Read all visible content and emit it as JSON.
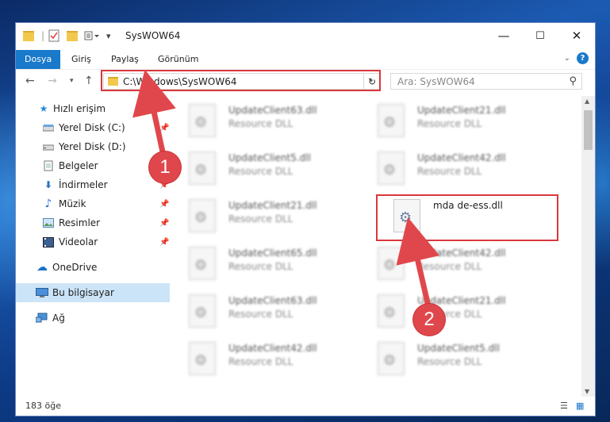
{
  "window": {
    "title": "SysWOW64",
    "controls": {
      "minimize": "—",
      "maximize": "☐",
      "close": "✕"
    }
  },
  "ribbon": {
    "tabs": [
      {
        "label": "Dosya",
        "active": true
      },
      {
        "label": "Giriş"
      },
      {
        "label": "Paylaş"
      },
      {
        "label": "Görünüm"
      }
    ],
    "help": "?"
  },
  "nav": {
    "address": "C:\\Windows\\SysWOW64",
    "search_placeholder": "Ara: SysWOW64"
  },
  "sidebar": {
    "items": [
      {
        "label": "Hızlı erişim",
        "icon": "star-icon"
      },
      {
        "label": "Yerel Disk (C:)",
        "icon": "drive-icon",
        "pinned": true
      },
      {
        "label": "Yerel Disk (D:)",
        "icon": "drive-icon"
      },
      {
        "label": "Belgeler",
        "icon": "documents-icon",
        "pinned": true
      },
      {
        "label": "İndirmeler",
        "icon": "download-icon",
        "pinned": true
      },
      {
        "label": "Müzik",
        "icon": "music-icon",
        "pinned": true
      },
      {
        "label": "Resimler",
        "icon": "pictures-icon",
        "pinned": true
      },
      {
        "label": "Videolar",
        "icon": "videos-icon",
        "pinned": true
      },
      {
        "label": "OneDrive",
        "icon": "cloud-icon"
      },
      {
        "label": "Bu bilgisayar",
        "icon": "computer-icon",
        "selected": true
      },
      {
        "label": "Ağ",
        "icon": "network-icon"
      }
    ]
  },
  "files": [
    {
      "name": "UpdateClient63.dll",
      "type": "Resource DLL"
    },
    {
      "name": "UpdateClient21.dll",
      "type": "Resource DLL"
    },
    {
      "name": "UpdateClient5.dll",
      "type": "Resource DLL"
    },
    {
      "name": "UpdateClient42.dll",
      "type": "Resource DLL"
    },
    {
      "name": "UpdateClient21.dll",
      "type": "Resource DLL"
    },
    {
      "name": "mda de-ess.dll",
      "type": "",
      "highlighted": true
    },
    {
      "name": "UpdateClient65.dll",
      "type": "Resource DLL"
    },
    {
      "name": "UpdateClient42.dll",
      "type": "Resource DLL"
    },
    {
      "name": "UpdateClient63.dll",
      "type": "Resource DLL"
    },
    {
      "name": "UpdateClient21.dll",
      "type": "Resource DLL"
    },
    {
      "name": "UpdateClient42.dll",
      "type": "Resource DLL"
    },
    {
      "name": "UpdateClient5.dll",
      "type": "Resource DLL"
    }
  ],
  "status": {
    "item_count": "183 öğe"
  },
  "annotations": {
    "badge1": "1",
    "badge2": "2",
    "color": "#e0474c"
  }
}
